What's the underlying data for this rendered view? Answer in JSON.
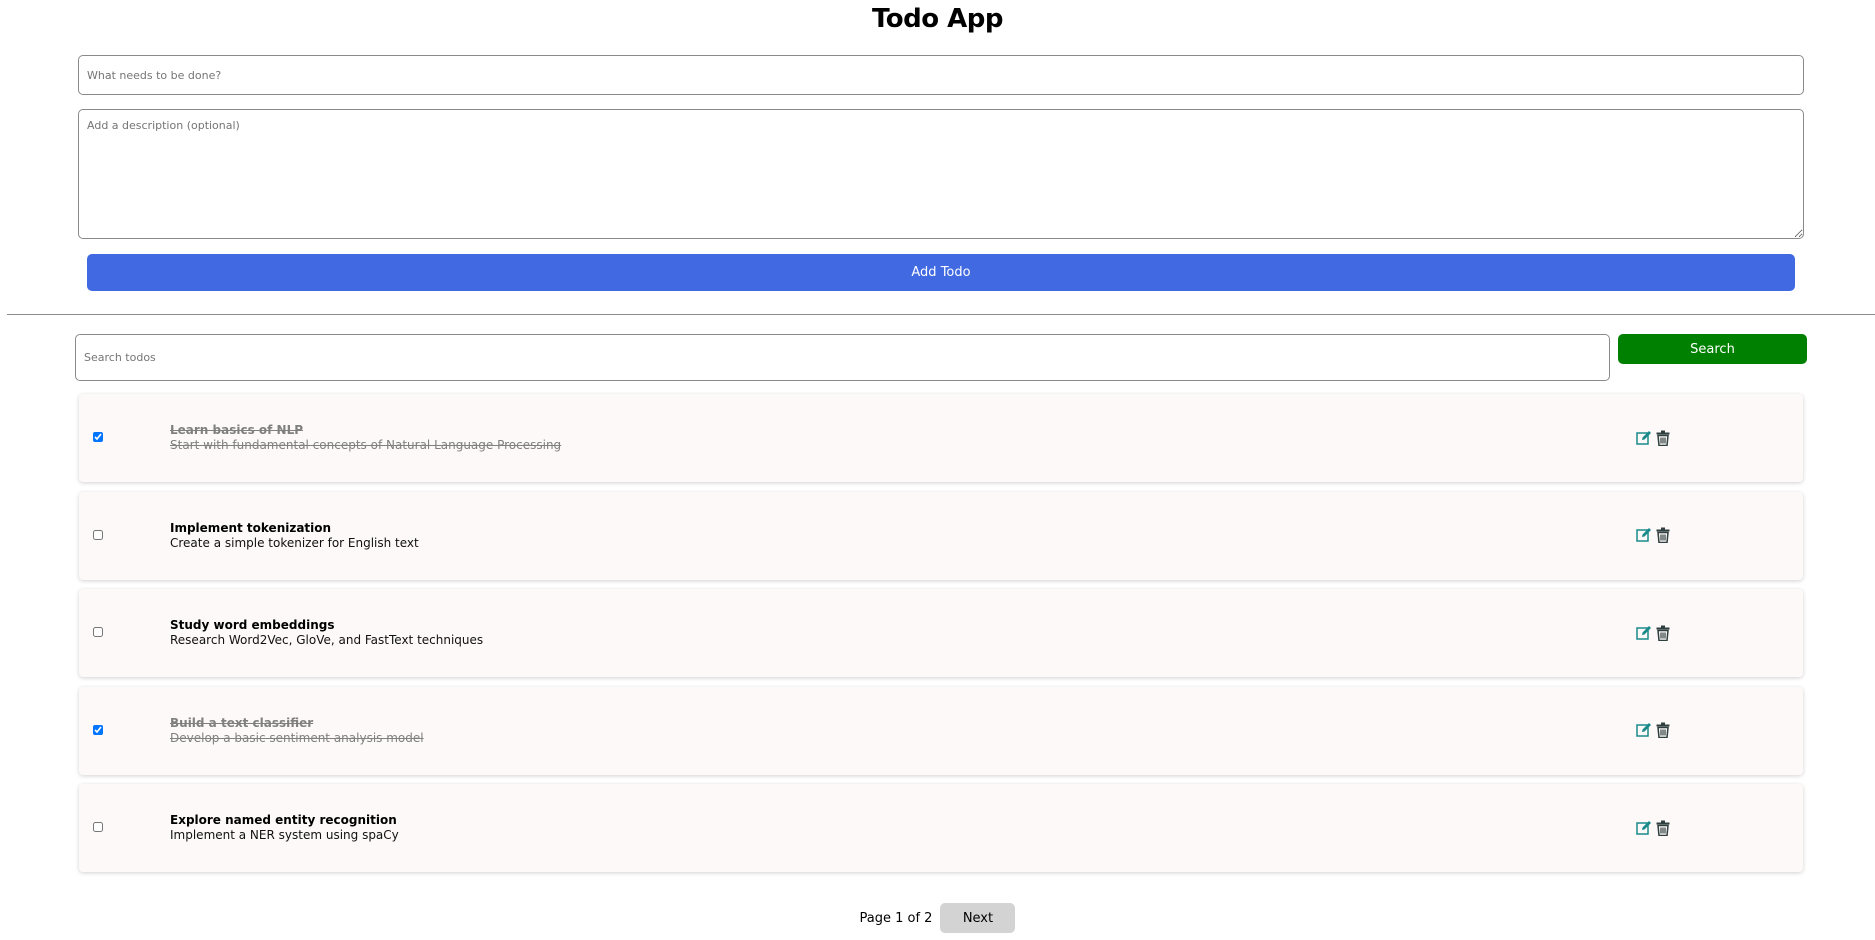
{
  "app": {
    "title": "Todo App"
  },
  "form": {
    "title_placeholder": "What needs to be done?",
    "title_value": "",
    "description_placeholder": "Add a description (optional)",
    "description_value": "",
    "add_label": "Add Todo",
    "add_color": "#4169e1"
  },
  "search": {
    "placeholder": "Search todos",
    "value": "",
    "button_label": "Search",
    "button_color": "#008000"
  },
  "todos": [
    {
      "title": "Learn basics of NLP",
      "description": "Start with fundamental concepts of Natural Language Processing",
      "completed": true
    },
    {
      "title": "Implement tokenization",
      "description": "Create a simple tokenizer for English text",
      "completed": false
    },
    {
      "title": "Study word embeddings",
      "description": "Research Word2Vec, GloVe, and FastText techniques",
      "completed": false
    },
    {
      "title": "Build a text classifier",
      "description": "Develop a basic sentiment analysis model",
      "completed": true
    },
    {
      "title": "Explore named entity recognition",
      "description": "Implement a NER system using spaCy",
      "completed": false
    }
  ],
  "icons": {
    "edit": "edit-icon",
    "delete": "trash-icon",
    "edit_color": "#1a8a8a",
    "delete_color": "#2f3f3f"
  },
  "pagination": {
    "page_info": "Page 1 of 2",
    "next_label": "Next"
  }
}
